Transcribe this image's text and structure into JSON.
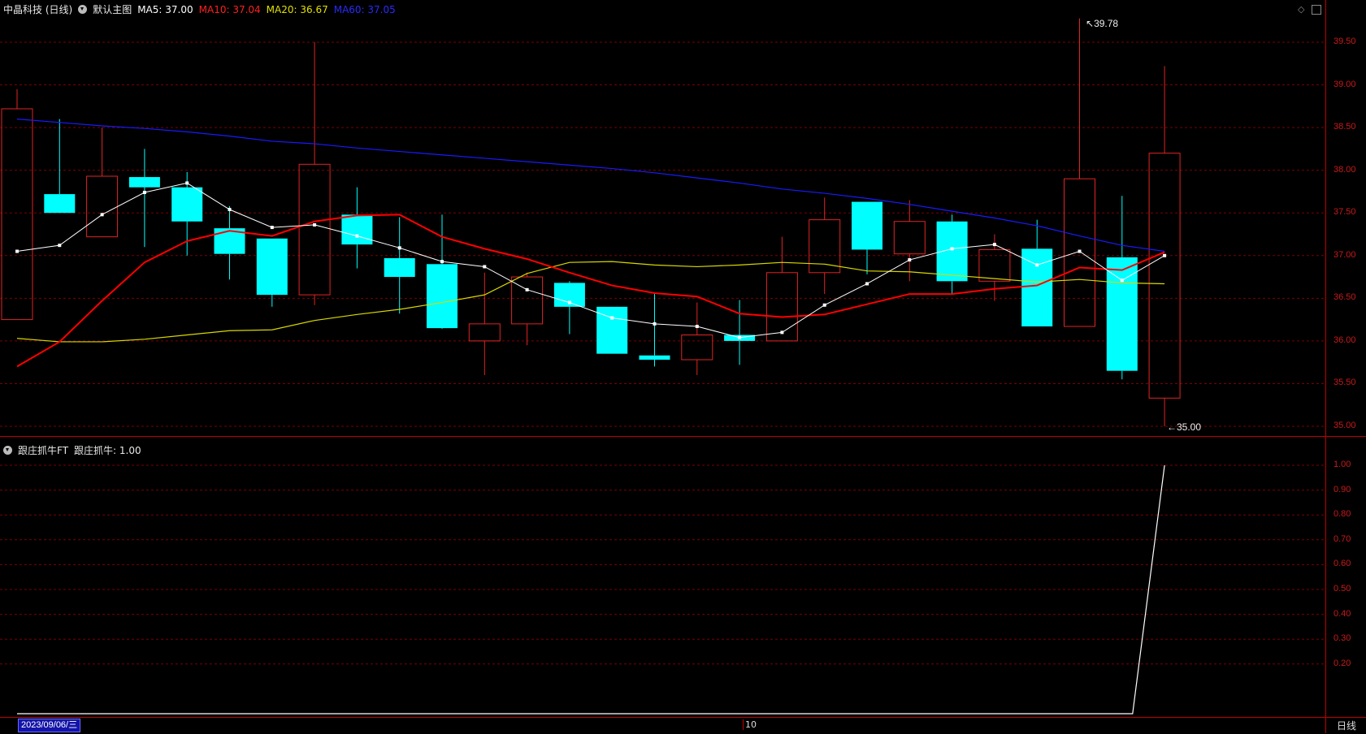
{
  "main_header": {
    "stock": "中晶科技 (日线)",
    "template": "默认主图",
    "ma5": "MA5: 37.00",
    "ma10": "MA10: 37.04",
    "ma20": "MA20: 36.67",
    "ma60": "MA60: 37.05"
  },
  "sub_header": {
    "indicator": "跟庄抓牛FT",
    "value": "跟庄抓牛: 1.00"
  },
  "colors": {
    "up": "#e02424",
    "down": "#00ffff",
    "ma5": "#ffffff",
    "ma10": "#ff0000",
    "ma20": "#d8d800",
    "ma60": "#1a1aff",
    "grid": "#7a0000"
  },
  "price_axis": [
    "39.50",
    "39.00",
    "38.50",
    "38.00",
    "37.50",
    "37.00",
    "36.50",
    "36.00",
    "35.50",
    "35.00"
  ],
  "indicator_axis": [
    "1.00",
    "0.90",
    "0.80",
    "0.70",
    "0.60",
    "0.50",
    "0.40",
    "0.30",
    "0.20"
  ],
  "annotations": {
    "high": "39.78",
    "low": "35.00"
  },
  "bottom": {
    "date": "2023/09/06/三",
    "month_mark": "10",
    "period": "日线"
  },
  "chart_data": {
    "type": "candlestick",
    "candles": [
      {
        "o": 36.25,
        "h": 38.95,
        "l": 36.25,
        "c": 38.72
      },
      {
        "o": 37.72,
        "h": 38.6,
        "l": 37.5,
        "c": 37.5
      },
      {
        "o": 37.22,
        "h": 38.5,
        "l": 37.22,
        "c": 37.93
      },
      {
        "o": 37.92,
        "h": 38.25,
        "l": 37.1,
        "c": 37.8
      },
      {
        "o": 37.8,
        "h": 37.98,
        "l": 37.0,
        "c": 37.4
      },
      {
        "o": 37.32,
        "h": 37.58,
        "l": 36.72,
        "c": 37.02
      },
      {
        "o": 37.2,
        "h": 37.2,
        "l": 36.4,
        "c": 36.54
      },
      {
        "o": 36.54,
        "h": 39.5,
        "l": 36.42,
        "c": 38.07
      },
      {
        "o": 37.48,
        "h": 37.8,
        "l": 36.85,
        "c": 37.13
      },
      {
        "o": 36.97,
        "h": 37.45,
        "l": 36.32,
        "c": 36.75
      },
      {
        "o": 36.9,
        "h": 37.48,
        "l": 36.14,
        "c": 36.15
      },
      {
        "o": 36.0,
        "h": 36.8,
        "l": 35.6,
        "c": 36.2
      },
      {
        "o": 36.2,
        "h": 36.8,
        "l": 35.95,
        "c": 36.75
      },
      {
        "o": 36.68,
        "h": 36.7,
        "l": 36.08,
        "c": 36.4
      },
      {
        "o": 36.4,
        "h": 36.4,
        "l": 35.85,
        "c": 35.85
      },
      {
        "o": 35.83,
        "h": 36.55,
        "l": 35.7,
        "c": 35.78
      },
      {
        "o": 35.78,
        "h": 36.45,
        "l": 35.6,
        "c": 36.07
      },
      {
        "o": 36.07,
        "h": 36.48,
        "l": 35.72,
        "c": 36.0
      },
      {
        "o": 36.0,
        "h": 37.22,
        "l": 36.0,
        "c": 36.8
      },
      {
        "o": 36.8,
        "h": 37.68,
        "l": 36.55,
        "c": 37.42
      },
      {
        "o": 37.63,
        "h": 37.63,
        "l": 36.78,
        "c": 37.07
      },
      {
        "o": 37.02,
        "h": 37.65,
        "l": 36.7,
        "c": 37.4
      },
      {
        "o": 37.4,
        "h": 37.48,
        "l": 36.55,
        "c": 36.7
      },
      {
        "o": 36.7,
        "h": 37.25,
        "l": 36.47,
        "c": 37.07
      },
      {
        "o": 37.08,
        "h": 37.42,
        "l": 36.17,
        "c": 36.17
      },
      {
        "o": 36.17,
        "h": 39.78,
        "l": 36.17,
        "c": 37.9
      },
      {
        "o": 36.98,
        "h": 37.7,
        "l": 35.55,
        "c": 35.65
      },
      {
        "o": 35.33,
        "h": 39.22,
        "l": 35.0,
        "c": 38.2
      }
    ],
    "ma5": [
      37.05,
      37.12,
      37.48,
      37.74,
      37.85,
      37.54,
      37.33,
      37.36,
      37.23,
      37.09,
      36.93,
      36.87,
      36.6,
      36.45,
      36.27,
      36.2,
      36.17,
      36.04,
      36.1,
      36.42,
      36.67,
      36.95,
      37.08,
      37.13,
      36.89,
      37.05,
      36.71,
      37.0
    ],
    "ma10": [
      35.7,
      35.99,
      36.47,
      36.92,
      37.17,
      37.29,
      37.23,
      37.4,
      37.47,
      37.48,
      37.22,
      37.08,
      36.96,
      36.8,
      36.65,
      36.56,
      36.52,
      36.32,
      36.28,
      36.31,
      36.43,
      36.55,
      36.55,
      36.61,
      36.65,
      36.86,
      36.83,
      37.04
    ],
    "ma20": [
      36.03,
      35.99,
      35.99,
      36.02,
      36.07,
      36.12,
      36.13,
      36.24,
      36.31,
      36.37,
      36.45,
      36.54,
      36.79,
      36.92,
      36.93,
      36.89,
      36.87,
      36.89,
      36.92,
      36.9,
      36.82,
      36.81,
      36.77,
      36.73,
      36.69,
      36.72,
      36.68,
      36.67
    ],
    "ma60": [
      38.6,
      38.56,
      38.52,
      38.49,
      38.45,
      38.4,
      38.34,
      38.31,
      38.26,
      38.22,
      38.18,
      38.14,
      38.1,
      38.06,
      38.02,
      37.97,
      37.91,
      37.85,
      37.78,
      37.73,
      37.67,
      37.6,
      37.52,
      37.44,
      37.35,
      37.23,
      37.12,
      37.05
    ],
    "indicator": [
      0,
      0,
      0,
      0,
      0,
      0,
      0,
      0,
      0,
      0,
      0,
      0,
      0,
      0,
      0,
      0,
      0,
      0,
      0,
      0,
      0,
      0,
      0,
      0,
      0,
      0,
      0,
      1.0
    ],
    "price_range": [
      35.0,
      39.78
    ],
    "indicator_range": [
      0,
      1.0
    ],
    "grid": true
  }
}
